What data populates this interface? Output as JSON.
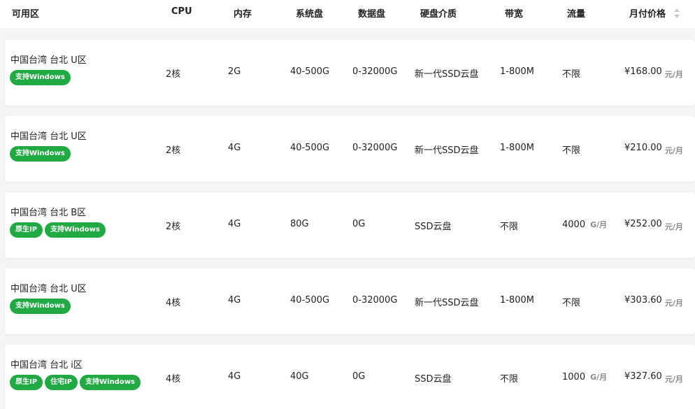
{
  "headers": {
    "zone": "可用区",
    "cpu": "CPU",
    "memory": "内存",
    "system_disk": "系统盘",
    "data_disk": "数据盘",
    "disk_type": "硬盘介质",
    "bandwidth": "带宽",
    "traffic": "流量",
    "monthly_price": "月付价格"
  },
  "rows": [
    {
      "zone": "中国台湾 台北 U区",
      "tags": [
        "支持Windows"
      ],
      "cpu": "2核",
      "memory": "2G",
      "system_disk": "40-500G",
      "data_disk": "0-32000G",
      "disk_type": "新一代SSD云盘",
      "bandwidth": "1-800M",
      "traffic": "不限",
      "traffic_unit": "",
      "price": "¥168.00",
      "price_unit": "元/月"
    },
    {
      "zone": "中国台湾 台北 U区",
      "tags": [
        "支持Windows"
      ],
      "cpu": "2核",
      "memory": "4G",
      "system_disk": "40-500G",
      "data_disk": "0-32000G",
      "disk_type": "新一代SSD云盘",
      "bandwidth": "1-800M",
      "traffic": "不限",
      "traffic_unit": "",
      "price": "¥210.00",
      "price_unit": "元/月"
    },
    {
      "zone": "中国台湾 台北 B区",
      "tags": [
        "原生IP",
        "支持Windows"
      ],
      "cpu": "2核",
      "memory": "4G",
      "system_disk": "80G",
      "data_disk": "0G",
      "disk_type": "SSD云盘",
      "bandwidth": "不限",
      "traffic": "4000",
      "traffic_unit": "G/月",
      "price": "¥252.00",
      "price_unit": "元/月"
    },
    {
      "zone": "中国台湾 台北 U区",
      "tags": [
        "支持Windows"
      ],
      "cpu": "4核",
      "memory": "4G",
      "system_disk": "40-500G",
      "data_disk": "0-32000G",
      "disk_type": "新一代SSD云盘",
      "bandwidth": "1-800M",
      "traffic": "不限",
      "traffic_unit": "",
      "price": "¥303.60",
      "price_unit": "元/月"
    },
    {
      "zone": "中国台湾 台北 i区",
      "tags": [
        "原生IP",
        "住宅IP",
        "支持Windows"
      ],
      "cpu": "4核",
      "memory": "4G",
      "system_disk": "40G",
      "data_disk": "0G",
      "disk_type": "SSD云盘",
      "bandwidth": "不限",
      "traffic": "1000",
      "traffic_unit": "G/月",
      "price": "¥327.60",
      "price_unit": "元/月"
    }
  ],
  "colors": {
    "tag_bg": "#21a943",
    "muted": "#8a8a8a",
    "background": "#f4f5f7"
  },
  "icons": {
    "sort": "sort-icon"
  }
}
